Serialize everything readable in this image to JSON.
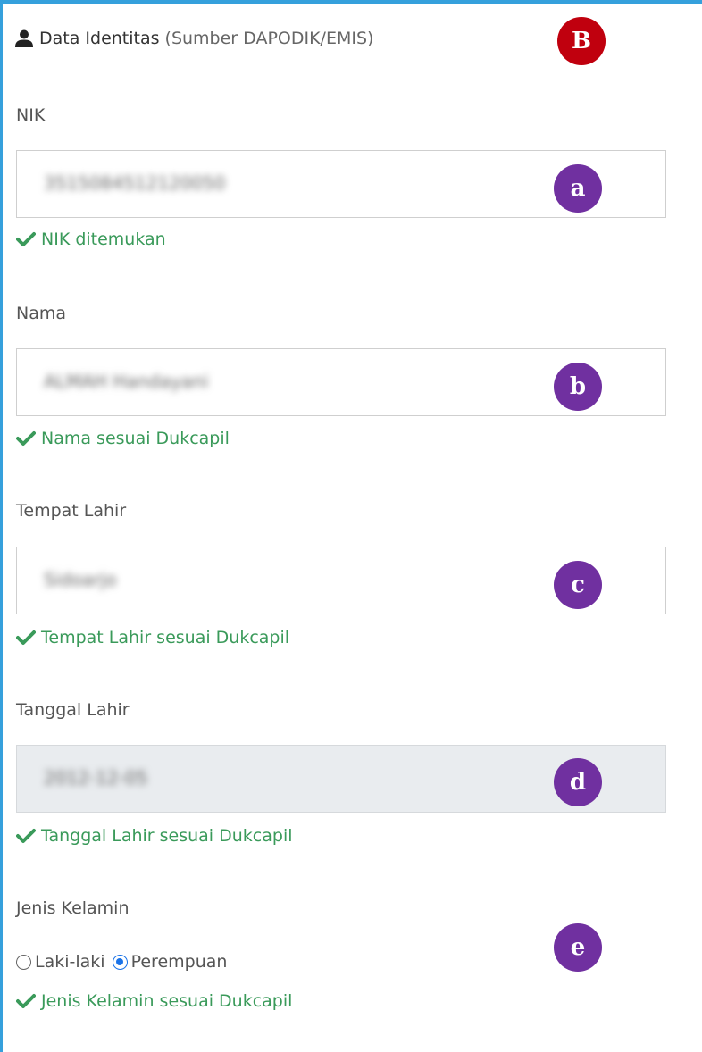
{
  "section": {
    "title": "Data Identitas",
    "source": "(Sumber DAPODIK/EMIS)",
    "icon": "user-icon"
  },
  "fields": {
    "nik": {
      "label": "NIK",
      "value": "3515084512120050",
      "valid": "NIK ditemukan"
    },
    "nama": {
      "label": "Nama",
      "value": "ALMAH Handayani",
      "valid": "Nama sesuai Dukcapil"
    },
    "tempat_lahir": {
      "label": "Tempat Lahir",
      "value": "Sidoarjo",
      "valid": "Tempat Lahir sesuai Dukcapil"
    },
    "tanggal_lahir": {
      "label": "Tanggal Lahir",
      "value": "2012-12-05",
      "valid": "Tanggal Lahir sesuai Dukcapil"
    },
    "jenis_kelamin": {
      "label": "Jenis Kelamin",
      "options": [
        "Laki-laki",
        "Perempuan"
      ],
      "selected": "Perempuan",
      "valid": "Jenis Kelamin sesuai Dukcapil"
    }
  },
  "badges": {
    "B": "B",
    "a": "a",
    "b": "b",
    "c": "c",
    "d": "d",
    "e": "e"
  },
  "colors": {
    "frame": "#35a0dc",
    "valid": "#3a9a5a",
    "badge_red": "#c0000e",
    "badge_purple": "#7030a0",
    "radio": "#1a73e8"
  }
}
